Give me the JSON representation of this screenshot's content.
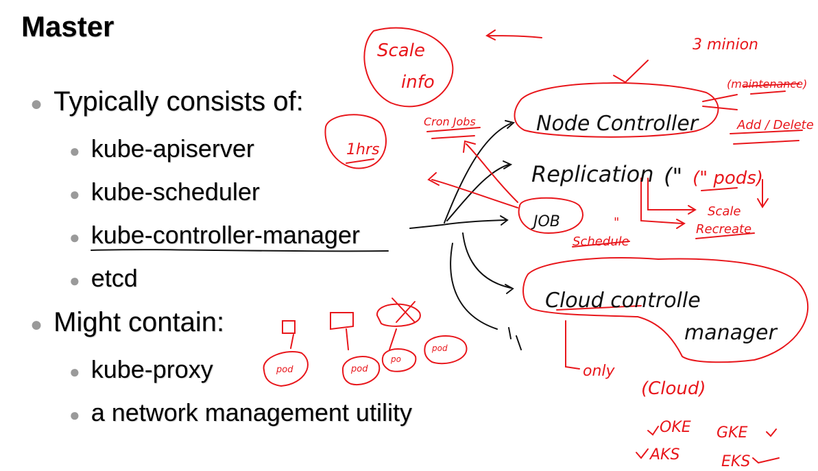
{
  "slide": {
    "title": "Master",
    "bullets": [
      {
        "text": "Typically consists of:",
        "children": [
          "kube-apiserver",
          "kube-scheduler",
          "kube-controller-manager",
          "etcd"
        ]
      },
      {
        "text": "Might contain:",
        "children": [
          "kube-proxy",
          "a network management utility"
        ]
      }
    ]
  },
  "annotations": {
    "scale_info": "Scale\ninfo",
    "three_minion": "3 minion",
    "cron_jobs": "Cron Jobs",
    "one_hrs": "1hrs",
    "node_controller": "Node Controller",
    "maintenance": "(maintenance)",
    "add_delete": "Add / Delete",
    "replication": "Replication",
    "pods": "(\" pods)",
    "job": "JOB",
    "schedule_quote": "\"",
    "schedule": "Schedule",
    "scale": "Scale",
    "recreate": "Recreate",
    "cloud_controller": "Cloud controlle",
    "manager": "manager",
    "quote_marks": "(\"",
    "only": "only",
    "cloud": "(Cloud)",
    "oke": "OKE",
    "gke": "GKE",
    "aks": "AKS",
    "eks": "EKS",
    "pod1": "pod",
    "pod2": "pod",
    "pod3": "po",
    "pod4": "pod"
  },
  "colors": {
    "ink_red": "#e8161b",
    "ink_black": "#111111",
    "bullet_gray": "#9a9a9a"
  }
}
